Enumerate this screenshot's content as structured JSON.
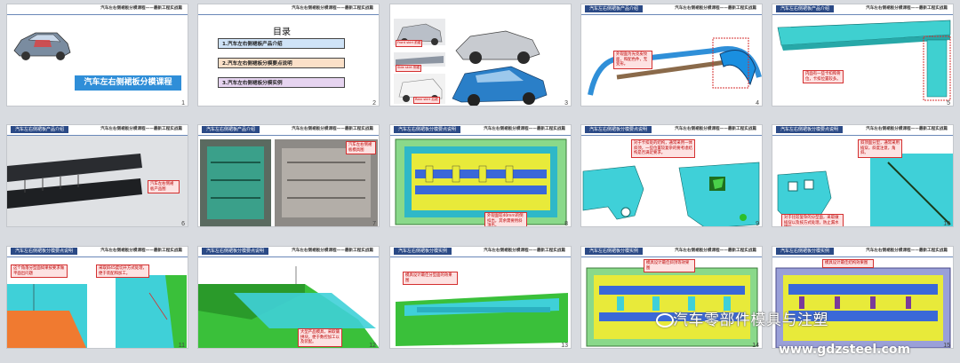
{
  "header_right": "汽车左右侧裙板分模课程——最新工程实战篇",
  "slide1": {
    "title": "汽车左右侧裙板分模课程",
    "num": "1"
  },
  "slide2": {
    "heading": "目录",
    "items": [
      "1.汽车左右侧裙板产品介绍",
      "2.汽车左右侧裙板分模要点说明",
      "3.汽车左右侧裙板分模实例"
    ],
    "colors": [
      "#cfe3f7",
      "#fbe0c8",
      "#e6d4f0"
    ],
    "num": "2"
  },
  "slide3": {
    "labels": [
      "Front skirt 前裙",
      "Side skirt 侧裙",
      "Rear skirt 后裙"
    ],
    "num": "3"
  },
  "slide4": {
    "tag": "汽车左右侧裙板产品介绍",
    "callout": "外观面为光亮皮纹面，和配色件，无变形。",
    "num": "4"
  },
  "slide5": {
    "tag": "汽车左右侧裙板产品介绍",
    "callout": "内面有一些卡扣和骨位，卡扣位置较多。",
    "num": "5"
  },
  "slide6": {
    "tag": "汽车左右侧裙板产品介绍",
    "callout": "汽车左右侧裙板产品图",
    "num": "6"
  },
  "slide7": {
    "tag": "汽车左右侧裙板产品介绍",
    "callout": "汽车左右侧裙板模具图",
    "num": "7"
  },
  "slide8": {
    "tag": "汽车左右侧裙板分模要点说明",
    "callout": "外观面较40mm的倒扣出，其余需要用斜顶出。",
    "num": "8"
  },
  "slide9": {
    "tag": "汽车左右侧裙板分模要点说明",
    "callout": "对于卡扣处的结构，通常采用一体斜顶，一些位置较复杂的要考虑结构是否满足要求。",
    "num": "9"
  },
  "slide10": {
    "tag": "汽车左右侧裙板分模要点说明",
    "callouts": [
      "斜顶面分型，通常采用插穿，斜度注意，角斜。",
      "对于比较复杂的分型面，采取做插穿以及按方式处理，防止漏水擦烂。"
    ],
    "num": "10"
  },
  "slide11": {
    "tag": "汽车左右侧裙板分模要点说明",
    "callouts": [
      "这个角落分型面如果按要求做平面出问题",
      "采取斜45度切开方式处理，便于装配和加工。"
    ],
    "num": "11"
  },
  "slide12": {
    "tag": "汽车左右侧裙板分模要点说明",
    "callout": "大型产品模具，采取镶拼块，便于数控加工以及装配。",
    "num": "12"
  },
  "slide13": {
    "tag": "汽车左右侧裙板分模实例",
    "callout": "模具设计最佳分型面的效果图",
    "num": "13"
  },
  "slide14": {
    "tag": "汽车左右侧裙板分模实例",
    "callout": "模具设计最佳斜顶等效果图",
    "num": "14"
  },
  "slide15": {
    "tag": "汽车左右侧裙板分模实例",
    "callout": "模具设计最佳结构效果图",
    "num": "15"
  },
  "watermark": "汽车零部件模具与注塑",
  "site": "www.gdzsteel.com"
}
